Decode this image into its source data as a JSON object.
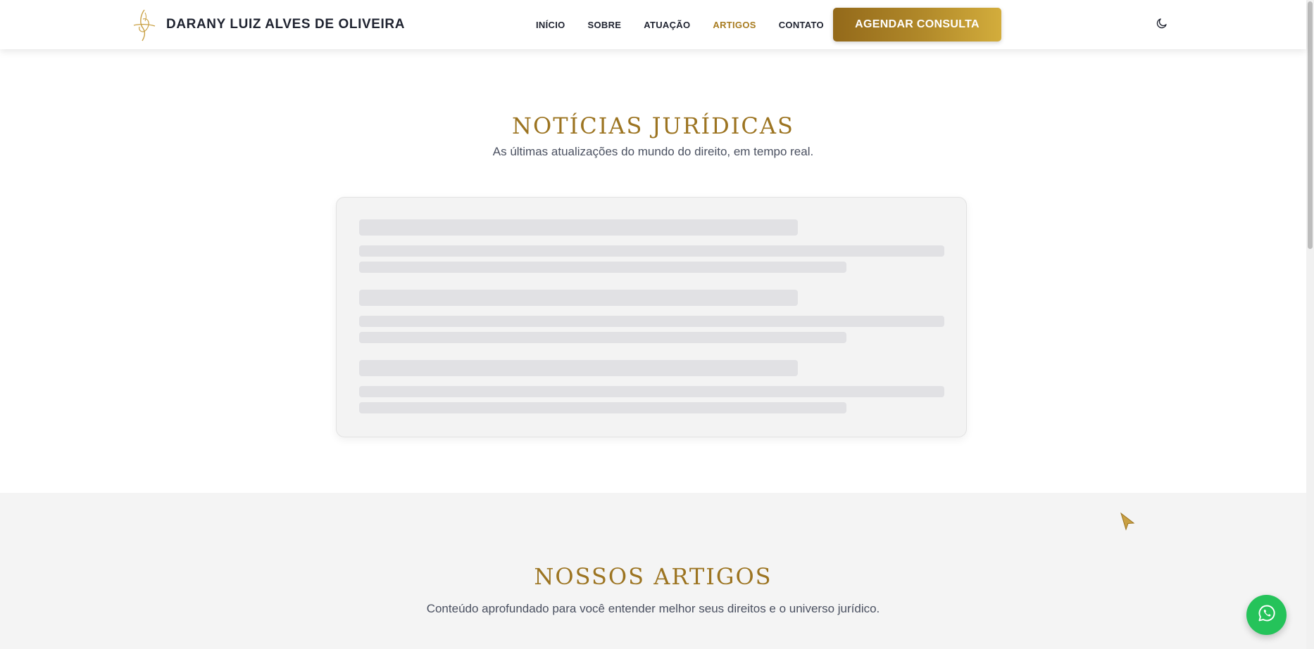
{
  "header": {
    "brand_name": "DARANY LUIZ ALVES DE OLIVEIRA",
    "logo_icon": "signature-monogram-icon",
    "nav": [
      {
        "label": "INÍCIO",
        "active": false
      },
      {
        "label": "SOBRE",
        "active": false
      },
      {
        "label": "ATUAÇÃO",
        "active": false
      },
      {
        "label": "ARTIGOS",
        "active": true
      },
      {
        "label": "CONTATO",
        "active": false
      }
    ],
    "cta_label": "AGENDAR CONSULTA",
    "theme_toggle_icon": "moon-icon"
  },
  "news": {
    "title": "NOTÍCIAS JURÍDICAS",
    "subtitle": "As últimas atualizações do mundo do direito, em tempo real.",
    "skeleton_groups": 3
  },
  "articles": {
    "title": "NOSSOS ARTIGOS",
    "subtitle": "Conteúdo aprofundado para você entender melhor seus direitos e o universo jurídico."
  },
  "floating": {
    "whatsapp_icon": "whatsapp-icon"
  },
  "colors": {
    "gold": "#9c7421",
    "active_nav": "#a87c20",
    "cta_gradient_start": "#93691a",
    "cta_gradient_end": "#d3ad3c",
    "whatsapp": "#25c35a",
    "skeleton_bar": "#e1e1e4",
    "skeleton_card": "#f3f3f3"
  }
}
